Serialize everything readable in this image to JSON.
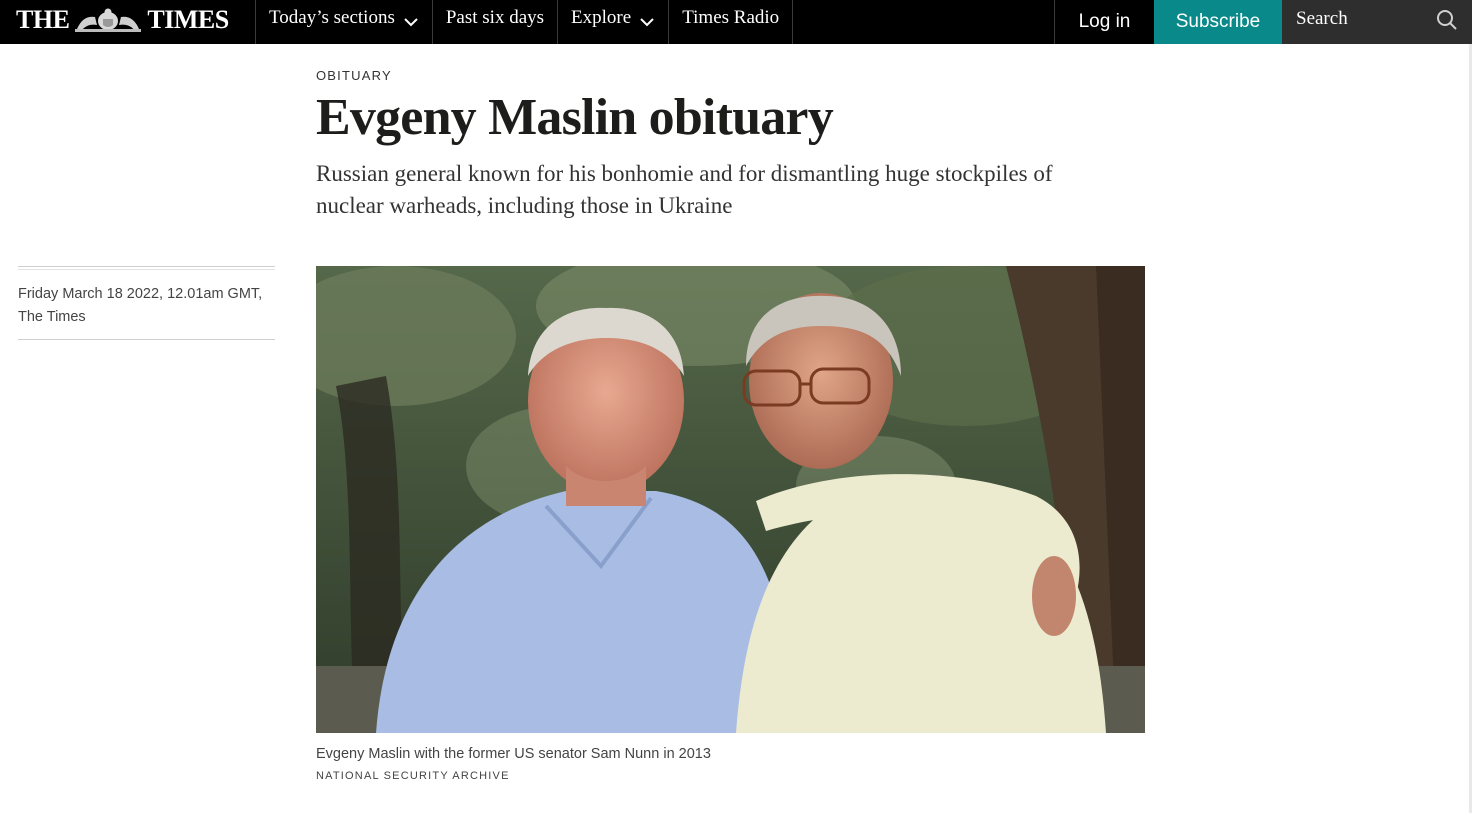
{
  "header": {
    "masthead_left": "THE",
    "masthead_right": "TIMES",
    "nav": [
      {
        "label": "Today’s sections",
        "icon": "chevron-down-icon"
      },
      {
        "label": "Past six days"
      },
      {
        "label": "Explore",
        "icon": "chevron-down-icon"
      },
      {
        "label": "Times Radio"
      }
    ],
    "login_label": "Log in",
    "subscribe_label": "Subscribe",
    "search_placeholder": "Search",
    "colors": {
      "bar": "#000000",
      "subscribe": "#0a898a",
      "search_bg": "#2e2e2e"
    }
  },
  "article": {
    "section": "OBITUARY",
    "headline": "Evgeny Maslin obituary",
    "standfirst": "Russian general known for his bonhomie and for dismantling huge stockpiles of nuclear warheads, including those in Ukraine",
    "date": "Friday March 18 2022, 12.01am GMT,",
    "publication": "The Times",
    "image": {
      "caption": "Evgeny Maslin with the former US senator Sam Nunn in 2013",
      "credit": "NATIONAL SECURITY ARCHIVE"
    }
  }
}
